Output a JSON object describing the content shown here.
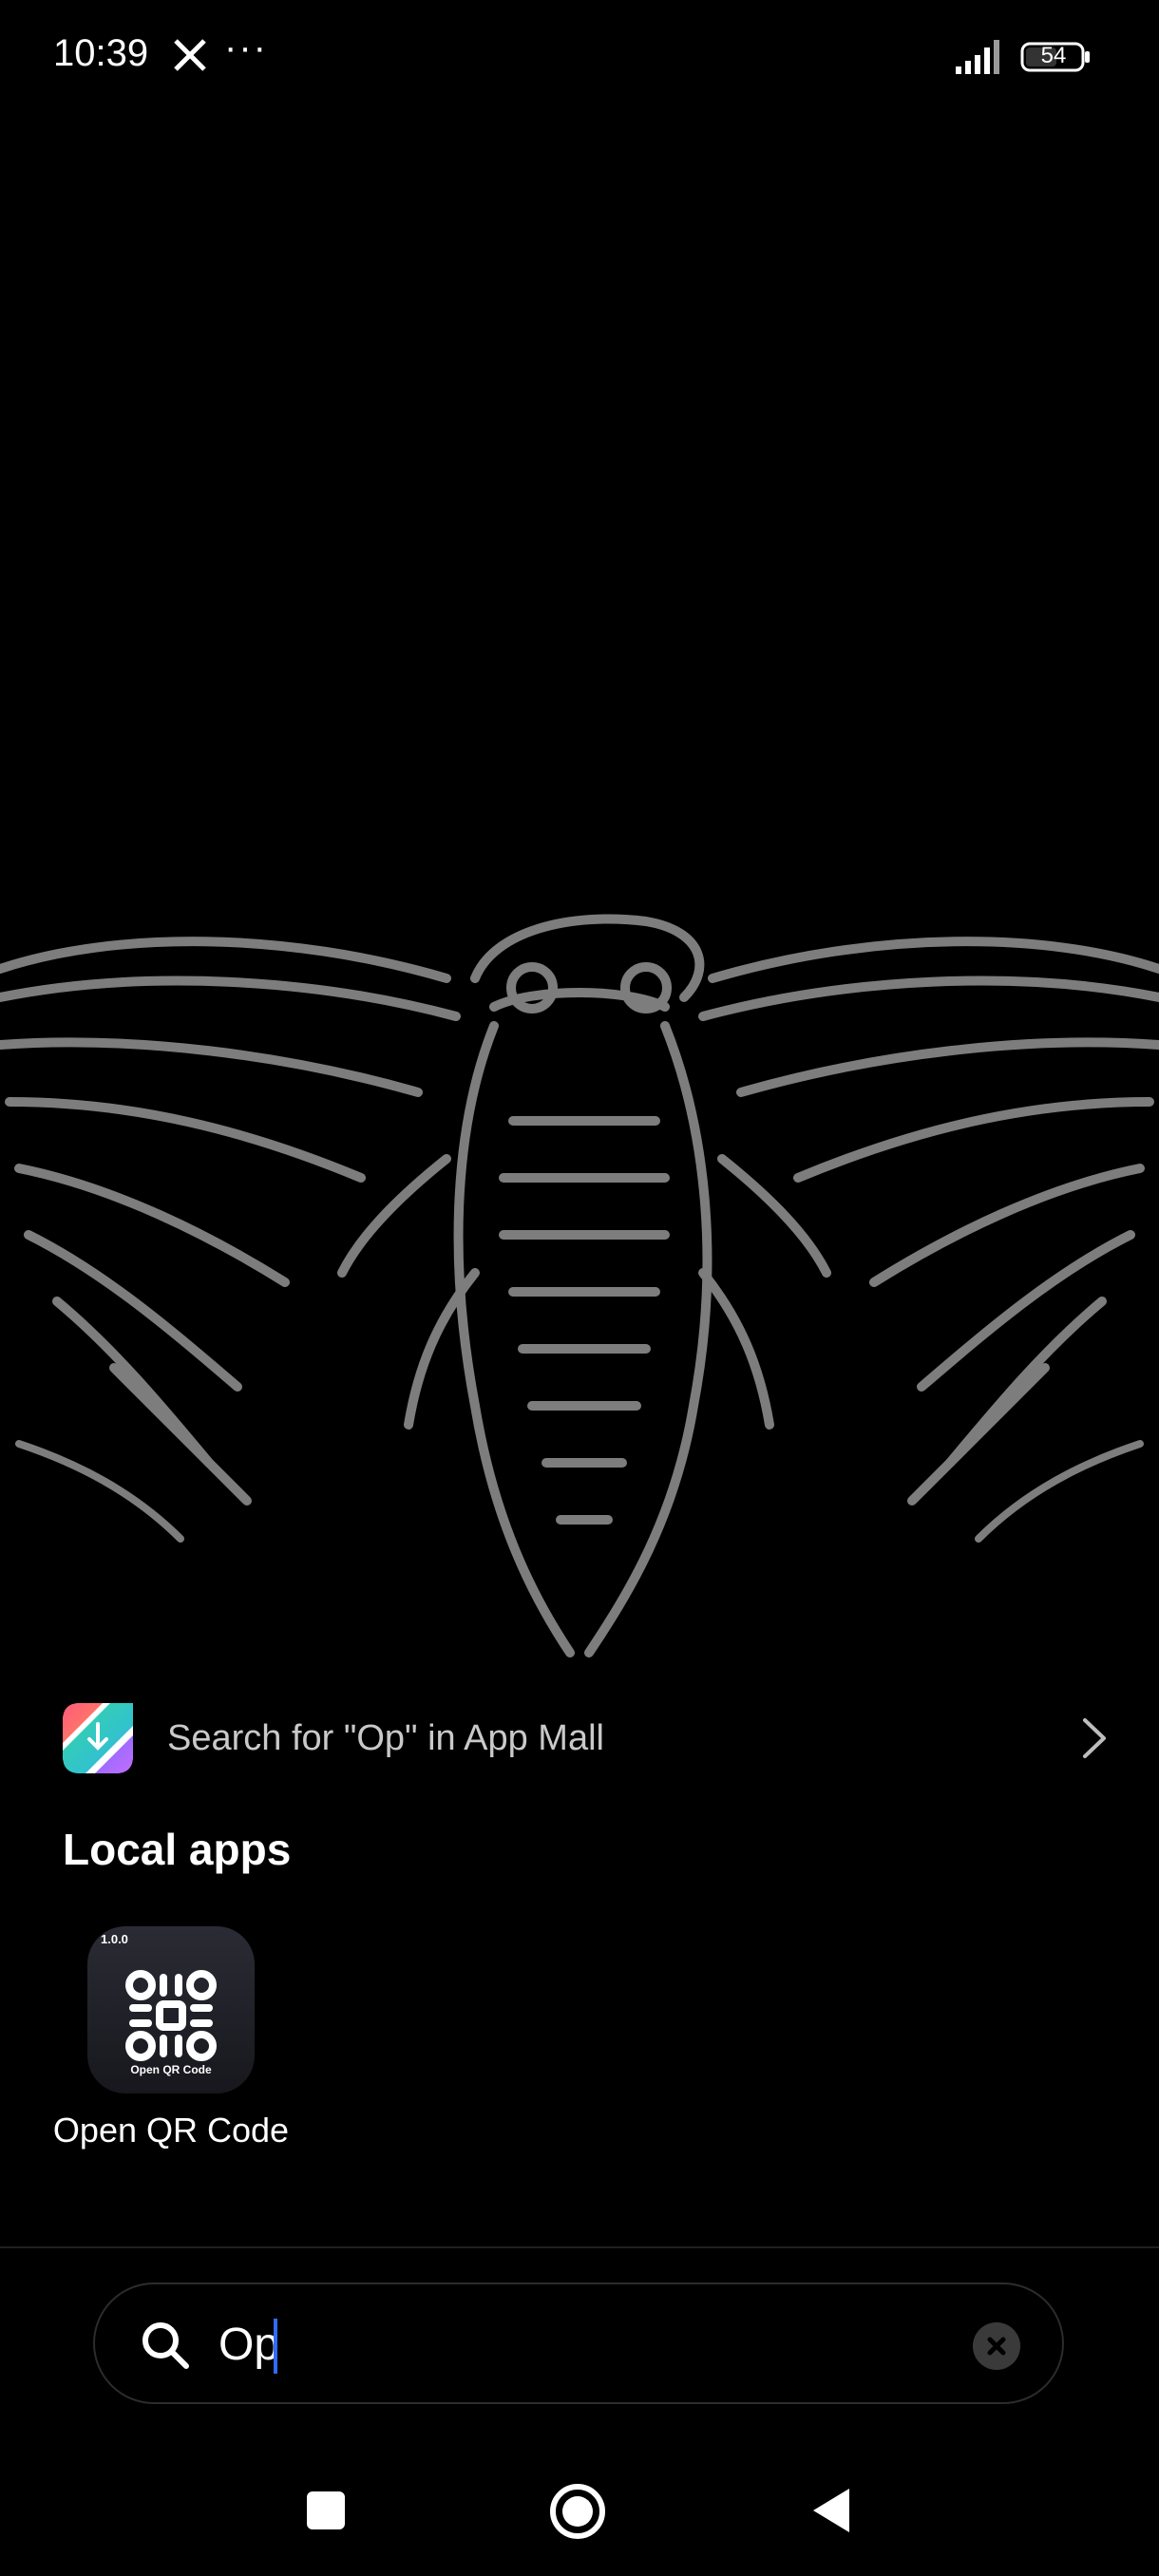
{
  "status_bar": {
    "time": "10:39",
    "app_icons": [
      "x-icon",
      "more-icon"
    ],
    "more_glyph": "···",
    "battery_level": "54",
    "signal_icon": "signal-icon"
  },
  "suggestion": {
    "text": "Search for \"Op\" in App Mall",
    "icon": "app-mall-icon"
  },
  "local_apps": {
    "title": "Local apps",
    "items": [
      {
        "name": "Open QR Code",
        "icon_version": "1.0.0",
        "icon_caption": "Open QR Code"
      }
    ]
  },
  "search": {
    "value": "Op",
    "clear_icon": "clear-icon"
  },
  "navigation": {
    "buttons": [
      "recents",
      "home",
      "back"
    ]
  },
  "colors": {
    "background": "#000000",
    "accent_caret": "#2f6bff",
    "suggestion_text": "#c9c9c9"
  }
}
